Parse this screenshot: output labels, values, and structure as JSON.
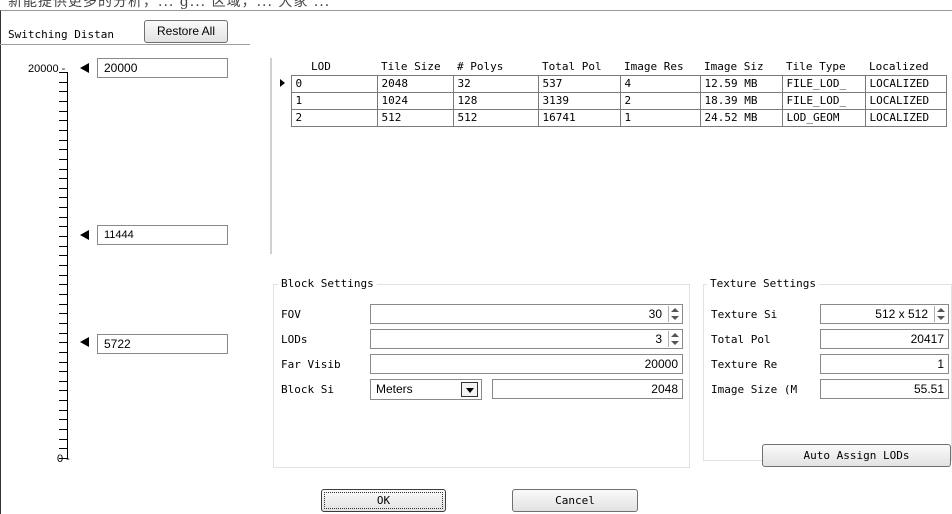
{
  "top_fragment": "新能提供更多的分析，... g... 区域，... 大家 ...",
  "switching": {
    "label": "Switching Distan",
    "restore_label": "Restore All",
    "top_value": "20000 -",
    "bottom_value": "0 -",
    "markers": [
      "20000",
      "11444",
      "5722"
    ]
  },
  "table": {
    "columns": [
      "LOD",
      "Tile Size",
      "# Polys",
      "Total Pol",
      "Image Res",
      "Image Siz",
      "Tile Type",
      "Localized"
    ],
    "rows": [
      [
        "0",
        "2048",
        "32",
        "537",
        "4",
        "12.59 MB",
        "FILE_LOD_",
        "LOCALIZED"
      ],
      [
        "1",
        "1024",
        "128",
        "3139",
        "2",
        "18.39 MB",
        "FILE_LOD_",
        "LOCALIZED"
      ],
      [
        "2",
        "512",
        "512",
        "16741",
        "1",
        "24.52 MB",
        "LOD_GEOM",
        "LOCALIZED"
      ]
    ],
    "selected_row": 0
  },
  "block_settings": {
    "title": "Block Settings",
    "fov_label": "FOV",
    "fov_value": "30",
    "lods_label": "LODs",
    "lods_value": "3",
    "far_label": "Far Visib",
    "far_value": "20000",
    "block_label": "Block Si",
    "unit_value": "Meters",
    "block_value": "2048"
  },
  "texture_settings": {
    "title": "Texture Settings",
    "texture_size_label": "Texture Si",
    "texture_size_value": "512 x 512",
    "total_pol_label": "Total Pol",
    "total_pol_value": "20417",
    "texture_res_label": "Texture Re",
    "texture_res_value": "1",
    "image_size_label": "Image Size (M",
    "image_size_value": "55.51"
  },
  "buttons": {
    "auto_assign": "Auto Assign LODs",
    "ok": "OK",
    "cancel": "Cancel"
  }
}
